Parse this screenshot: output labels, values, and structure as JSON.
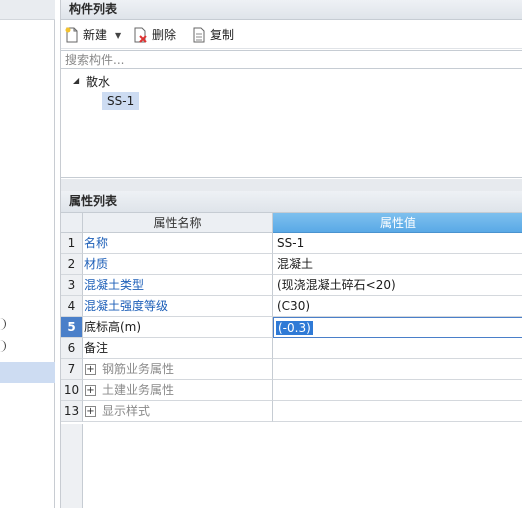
{
  "component_list": {
    "title": "构件列表",
    "toolbar": {
      "new_label": "新建",
      "delete_label": "删除",
      "copy_label": "复制"
    },
    "search": {
      "placeholder": "搜索构件..."
    },
    "tree": {
      "parent_label": "散水",
      "child_label": "SS-1"
    }
  },
  "property_list": {
    "title": "属性列表",
    "header": {
      "name": "属性名称",
      "value": "属性值"
    },
    "rows": [
      {
        "num": "1",
        "name": "名称",
        "value": "SS-1"
      },
      {
        "num": "2",
        "name": "材质",
        "value": "混凝土"
      },
      {
        "num": "3",
        "name": "混凝土类型",
        "value": "(现浇混凝土碎石<20)"
      },
      {
        "num": "4",
        "name": "混凝土强度等级",
        "value": "(C30)"
      },
      {
        "num": "5",
        "name": "底标高(m)",
        "value": "(-0.3)"
      },
      {
        "num": "6",
        "name": "备注",
        "value": ""
      },
      {
        "num": "7",
        "name": "钢筋业务属性",
        "value": ""
      },
      {
        "num": "10",
        "name": "土建业务属性",
        "value": ""
      },
      {
        "num": "13",
        "name": "显示样式",
        "value": ""
      }
    ]
  },
  "colors": {
    "accent_blue": "#5aa9e6",
    "selection": "#cddcf2",
    "link_blue": "#1d5fb8",
    "active_row": "#4a7fc9"
  }
}
